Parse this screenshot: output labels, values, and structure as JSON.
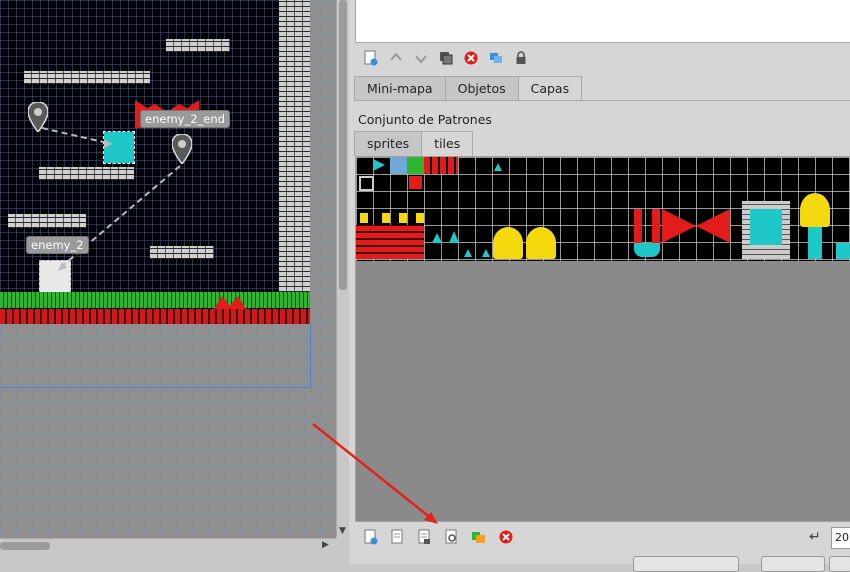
{
  "map": {
    "objects": [
      {
        "label": "enemy_2_end"
      },
      {
        "label": "enemy_2"
      }
    ]
  },
  "tabs_top": [
    {
      "label": "Mini-mapa",
      "active": false
    },
    {
      "label": "Objetos",
      "active": false
    },
    {
      "label": "Capas",
      "active": true
    }
  ],
  "panel_title": "Conjunto de Patrones",
  "tabs_tileset": [
    {
      "label": "sprites",
      "active": false
    },
    {
      "label": "tiles",
      "active": true
    }
  ],
  "top_toolbar_icons": [
    "new-layer-icon",
    "move-up-icon",
    "move-down-icon",
    "duplicate-icon",
    "remove-icon",
    "show-hide-icon",
    "lock-icon"
  ],
  "bottom_toolbar_icons": [
    "new-tileset-icon",
    "import-tileset-icon",
    "export-tileset-icon",
    "edit-tileset-icon",
    "tileset-properties-icon",
    "remove-tileset-icon"
  ],
  "zoom_value": "20",
  "colors": {
    "accent_red": "#e21b1b",
    "brick": "#d0d0d0",
    "grass": "#2fb52f",
    "tile_cyan": "#1ec8c8",
    "tile_yellow": "#f5d90f"
  }
}
